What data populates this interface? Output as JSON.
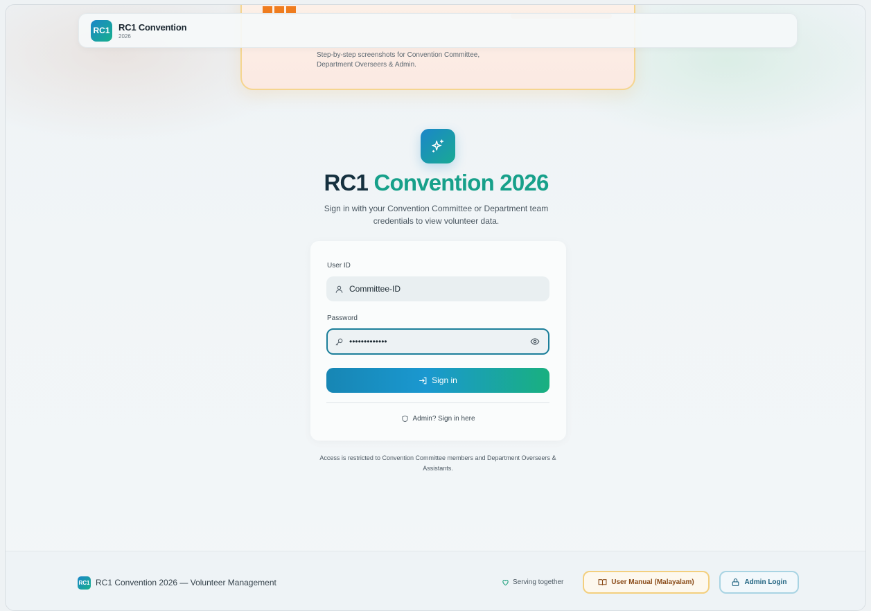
{
  "header": {
    "logo_text": "RC1",
    "brand_name": "RC1 Convention",
    "brand_year": "2026"
  },
  "promo": {
    "description": "Step-by-step screenshots for Convention Committee, Department Overseers & Admin."
  },
  "hero": {
    "icon": "sparkles-icon",
    "title_part1": "RC1",
    "title_part2": "Convention 2026",
    "subtitle": "Sign in with your Convention Committee or Department team credentials to view volunteer data."
  },
  "login": {
    "user_label": "User ID",
    "user_value": "Committee-ID",
    "password_label": "Password",
    "password_value": "•••••••••••••",
    "signin_label": "Sign in",
    "admin_link": "Admin? Sign in here"
  },
  "note": "Access is restricted to Convention Committee members and Department Overseers & Assistants.",
  "footer": {
    "logo_text": "RC1",
    "title": "RC1 Convention 2026 — Volunteer Management",
    "serving": "Serving together",
    "manual_button": "User Manual (Malayalam)",
    "admin_button": "Admin Login"
  },
  "colors": {
    "brand_blue": "#1b86c9",
    "brand_green": "#17b08c",
    "title_teal": "#17a08a",
    "manual_border": "#f3cf7e",
    "admin_border": "#a9d4e3"
  }
}
